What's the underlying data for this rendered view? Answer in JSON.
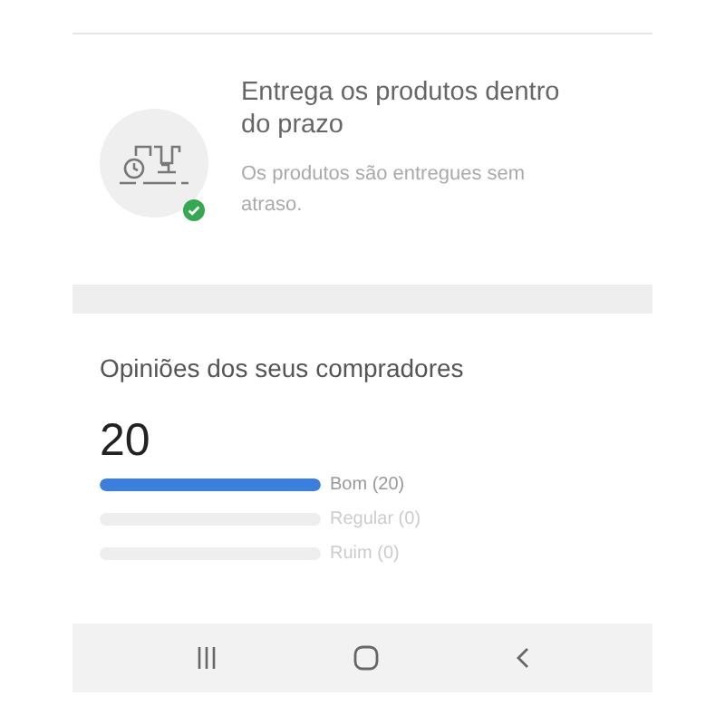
{
  "delivery": {
    "title": "Entrega os produtos dentro do prazo",
    "description": "Os produtos são entregues sem atraso.",
    "verified": true
  },
  "opinions": {
    "title": "Opiniões dos seus compradores",
    "total": "20",
    "ratings": [
      {
        "label": "Bom (20)",
        "level": 1
      },
      {
        "label": "Regular (0)",
        "level": 0
      },
      {
        "label": "Ruim (0)",
        "level": 0
      }
    ]
  }
}
